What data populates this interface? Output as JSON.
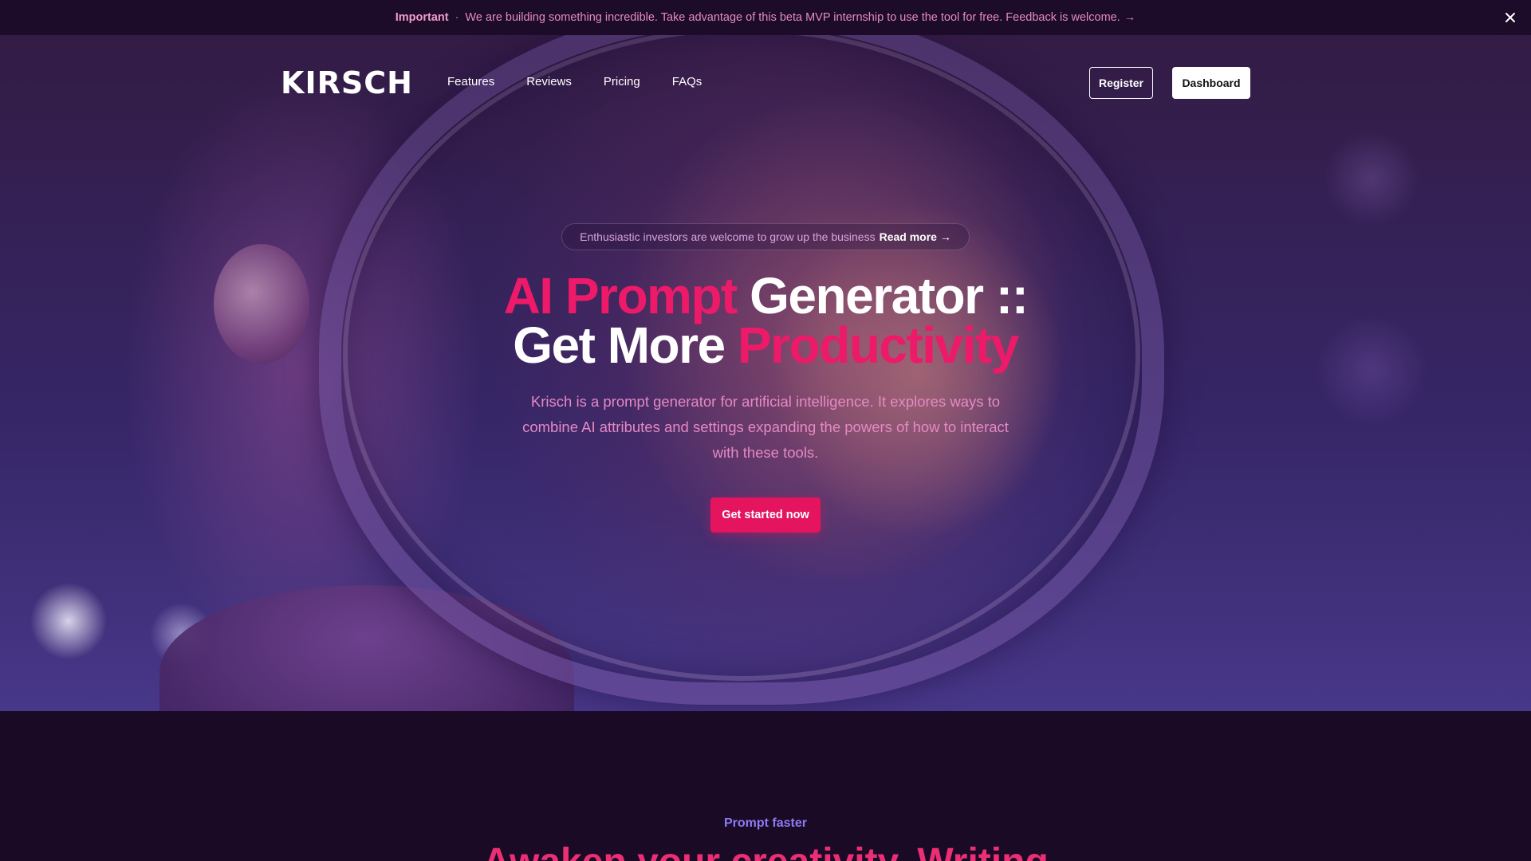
{
  "announcement": {
    "label": "Important",
    "separator": "·",
    "message": "We are building something incredible. Take advantage of this beta MVP internship to use the tool for free. Feedback is welcome.",
    "arrow": "→",
    "close_icon": "close-icon"
  },
  "nav": {
    "logo": "KIRSCH",
    "links": [
      "Features",
      "Reviews",
      "Pricing",
      "FAQs"
    ],
    "register_label": "Register",
    "dashboard_label": "Dashboard"
  },
  "hero": {
    "pill_text": "Enthusiastic investors are welcome to grow up the business",
    "pill_link": "Read more →",
    "headline": {
      "line1_pink": "AI Prompt",
      "line1_white": "Generator ::",
      "line2_white": "Get More",
      "line2_pink": "Productivity"
    },
    "description": "Krisch is a prompt generator for artificial intelligence. It explores ways to combine AI attributes and settings expanding the powers of how to interact with these tools.",
    "cta_label": "Get started now"
  },
  "section": {
    "eyebrow": "Prompt faster",
    "title": "Awaken your creativity. Writing"
  },
  "colors": {
    "accent_pink": "#ec1a69",
    "button_pink": "#e4145f",
    "eyebrow_purple": "#8b7cf0",
    "page_bg": "#1a0a26"
  }
}
